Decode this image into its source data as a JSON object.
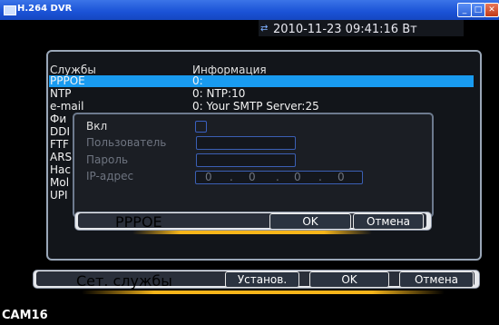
{
  "window": {
    "title": "H.264 DVR"
  },
  "datetime": "2010-11-23 09:41:16 Вт",
  "table": {
    "headers": [
      "Службы",
      "Информация"
    ],
    "rows": [
      {
        "name": "PPPOE",
        "info": "0:"
      },
      {
        "name": "NTP",
        "info": "0: NTP:10"
      },
      {
        "name": "e-mail",
        "info": "0: Your SMTP Server:25"
      },
      {
        "name": "Фи",
        "info": ""
      },
      {
        "name": "DDI",
        "info": ""
      },
      {
        "name": "FTF",
        "info": ""
      },
      {
        "name": "ARS",
        "info": ""
      },
      {
        "name": "Нас",
        "info": ""
      },
      {
        "name": "Mol",
        "info": ""
      },
      {
        "name": "UPI",
        "info": ""
      }
    ]
  },
  "dialog": {
    "enable_label": "Вкл",
    "user_label": "Пользователь",
    "password_label": "Пароль",
    "ip_label": "IP-адрес",
    "ip_octets": [
      "0",
      "0",
      "0",
      "0"
    ],
    "ip_sep": ".",
    "title": "PPPOE",
    "ok": "OK",
    "cancel": "Отмена"
  },
  "footer": {
    "title": "Сет. службы",
    "setup": "Установ.",
    "ok": "OK",
    "cancel": "Отмена"
  },
  "status": {
    "channel": "CAM16"
  },
  "colors": {
    "selection": "#199bf0",
    "titlebar": "#1a52d6",
    "glow": "#f6b51a"
  }
}
